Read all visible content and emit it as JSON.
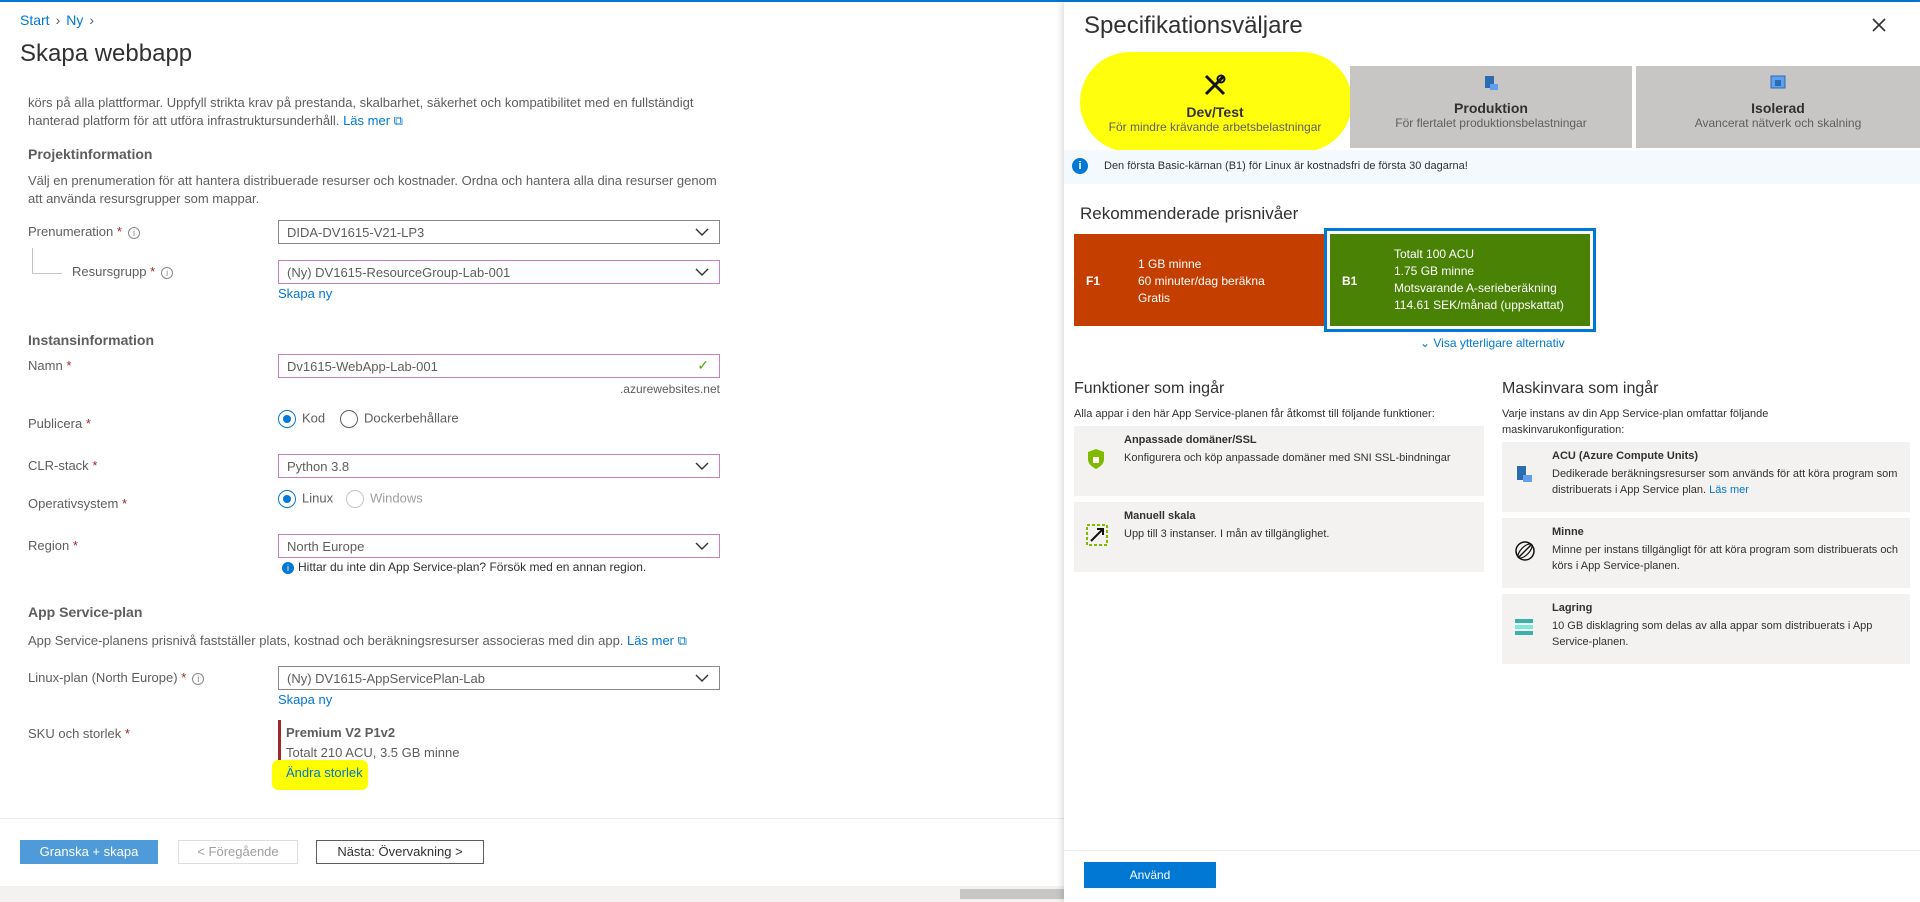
{
  "breadcrumb": {
    "items": [
      "Start",
      "Ny"
    ]
  },
  "blade": {
    "title": "Skapa webbapp",
    "intro_line1": "körs på alla plattformar. Uppfyll strikta krav på prestanda, skalbarhet, säkerhet och kompatibilitet med en fullständigt",
    "intro_line2": "hanterad platform för att utföra infrastruktursunderhåll.",
    "intro_link": "Läs mer",
    "project": {
      "heading": "Projektinformation",
      "desc_line1": "Välj en prenumeration för att hantera distribuerade resurser och kostnader. Ordna och hantera alla dina resurser genom",
      "desc_line2": "att använda resursgrupper som mappar.",
      "subscription_label": "Prenumeration",
      "subscription_value": "DIDA-DV1615-V21-LP3",
      "rg_label": "Resursgrupp",
      "rg_value": "(Ny) DV1615-ResourceGroup-Lab-001",
      "rg_create": "Skapa ny"
    },
    "instance": {
      "heading": "Instansinformation",
      "name_label": "Namn",
      "name_value": "Dv1615-WebApp-Lab-001",
      "name_suffix": ".azurewebsites.net",
      "publish_label": "Publicera",
      "publish_opt1": "Kod",
      "publish_opt2": "Dockerbehållare",
      "clr_label": "CLR-stack",
      "clr_value": "Python 3.8",
      "os_label": "Operativsystem",
      "os_opt1": "Linux",
      "os_opt2": "Windows",
      "region_label": "Region",
      "region_value": "North Europe",
      "region_hint": "Hittar du inte din App Service-plan? Försök med en annan region."
    },
    "plan": {
      "heading": "App Service-plan",
      "desc": "App Service-planens prisnivå fastställer plats, kostnad och beräkningsresurser associeras med din app.",
      "desc_link": "Läs mer",
      "linux_label": "Linux-plan (North Europe)",
      "linux_value": "(Ny) DV1615-AppServicePlan-Lab",
      "linux_create": "Skapa ny",
      "sku_label": "SKU och storlek",
      "sku_name": "Premium V2 P1v2",
      "sku_desc": "Totalt 210 ACU, 3.5 GB minne",
      "sku_change": "Ändra storlek"
    },
    "footer": {
      "review": "Granska + skapa",
      "prev": "< Föregående",
      "next": "Nästa: Övervakning >"
    }
  },
  "panel": {
    "title": "Specifikationsväljare",
    "tabs": [
      {
        "title": "Dev/Test",
        "sub": "För mindre krävande arbetsbelastningar"
      },
      {
        "title": "Produktion",
        "sub": "För flertalet produktionsbelastningar"
      },
      {
        "title": "Isolerad",
        "sub": "Avancerat nätverk och skalning"
      }
    ],
    "notice": "Den första Basic-kärnan (B1) för Linux är kostnadsfri de första 30 dagarna!",
    "recommended_heading": "Rekommenderade prisnivåer",
    "tiers": [
      {
        "code": "F1",
        "lines": [
          "1 GB minne",
          "60 minuter/dag beräkna",
          "Gratis"
        ]
      },
      {
        "code": "B1",
        "lines": [
          "Totalt 100 ACU",
          "1.75 GB minne",
          "Motsvarande A-serieberäkning",
          "114.61 SEK/månad (uppskattat)"
        ]
      }
    ],
    "more_options": "Visa ytterligare alternativ",
    "features": {
      "heading": "Funktioner som ingår",
      "sub": "Alla appar i den här App Service-planen får åtkomst till följande funktioner:",
      "cards": [
        {
          "title": "Anpassade domäner/SSL",
          "desc": "Konfigurera och köp anpassade domäner med SNI SSL-bindningar"
        },
        {
          "title": "Manuell skala",
          "desc": "Upp till 3 instanser. I mån av tillgänglighet."
        }
      ]
    },
    "hardware": {
      "heading": "Maskinvara som ingår",
      "sub_line1": "Varje instans av din App Service-plan omfattar följande",
      "sub_line2": "maskinvarukonfiguration:",
      "cards": [
        {
          "title": "ACU (Azure Compute Units)",
          "desc": "Dedikerade beräkningsresurser som används för att köra program som distribuerats i App Service plan.",
          "link": "Läs mer"
        },
        {
          "title": "Minne",
          "desc": "Minne per instans tillgängligt för att köra program som distribuerats och körs i App Service-planen."
        },
        {
          "title": "Lagring",
          "desc": "10 GB disklagring som delas av alla appar som distribuerats i App Service-planen."
        }
      ]
    },
    "apply": "Använd"
  },
  "colors": {
    "accent": "#0078d4",
    "f1": "#c43e00",
    "b1": "#498205",
    "highlight": "#ffff00"
  }
}
